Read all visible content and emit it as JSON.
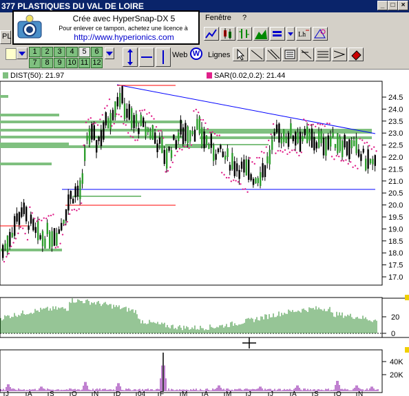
{
  "window": {
    "title": "377  PLASTIQUES DU VAL DE LOIRE"
  },
  "menu": {
    "items": [
      "Fenêtre",
      "?"
    ]
  },
  "toolbar": {
    "row2_label_lignes": "Lignes",
    "row2_label_web": "Web",
    "left_partial": "PL"
  },
  "period_buttons": {
    "row1": [
      "1",
      "2",
      "3",
      "4",
      "5",
      "6"
    ],
    "row2": [
      "7",
      "8",
      "9",
      "10",
      "11",
      "12"
    ],
    "selected": "5"
  },
  "hypersnap": {
    "line1": "Crée avec HyperSnap-DX 5",
    "line2": "Pour enlever ce tampon, achetez une licence à",
    "line3": "http://www.hyperionics.com"
  },
  "legend": {
    "dist": "DIST(50): 21.97",
    "sar": "SAR(0.02,0.2): 21.44",
    "dist_color": "#7fc07f",
    "sar_color": "#e0208a"
  },
  "price_axis": {
    "ticks": [
      "24.5",
      "24.0",
      "23.5",
      "23.0",
      "22.5",
      "22.0",
      "21.5",
      "21.0",
      "20.5",
      "20.0",
      "19.5",
      "19.0",
      "18.5",
      "18.0",
      "17.5",
      "17.0"
    ]
  },
  "indicator_axis": {
    "ticks": [
      "20",
      "0"
    ]
  },
  "volume_axis": {
    "ticks": [
      "40K",
      "20K"
    ]
  },
  "time_axis": {
    "labels": [
      "J",
      "A",
      "S",
      "O",
      "N",
      "D",
      "04",
      "F",
      "M",
      "A",
      "M",
      "J",
      "J",
      "A",
      "S",
      "O",
      "N"
    ]
  },
  "colors": {
    "candle_up": "#2e9e2e",
    "candle_down": "#000000",
    "trend_blue": "#0000ff",
    "red_line": "#ff0000",
    "volume": "#2e8b2e",
    "purple": "#8000a0"
  }
}
